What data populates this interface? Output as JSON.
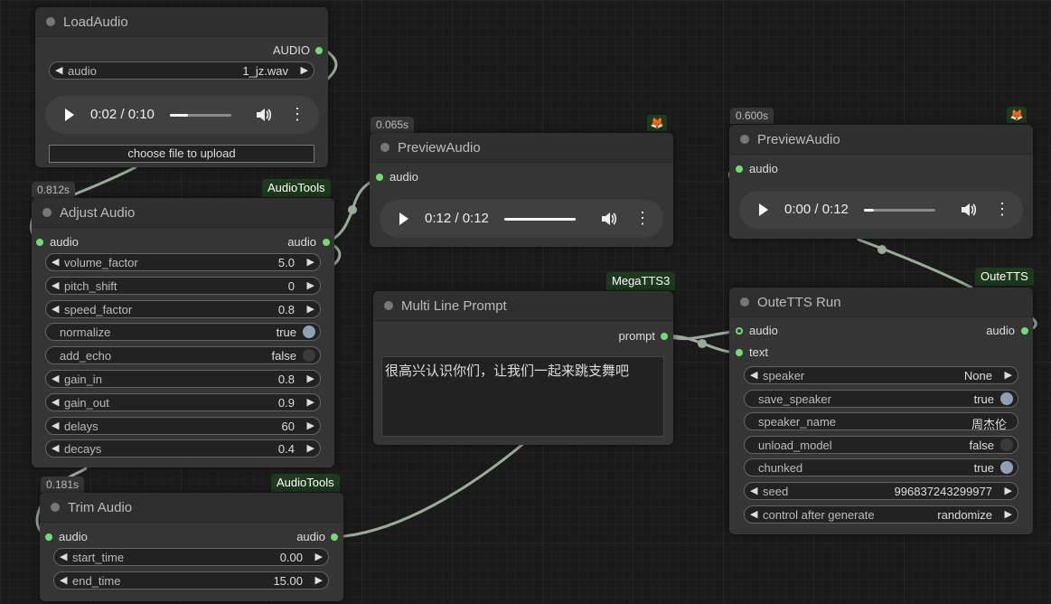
{
  "nodes": {
    "load_audio": {
      "title": "LoadAudio",
      "output_label": "AUDIO",
      "audio_label": "audio",
      "audio_value": "1_jz.wav",
      "player_time": "0:02 / 0:10",
      "player_progress": 0.3,
      "upload_label": "choose file to upload"
    },
    "adjust_audio": {
      "timing": "0.812s",
      "pack": "AudioTools",
      "title": "Adjust Audio",
      "input_label": "audio",
      "output_label": "audio",
      "widgets": [
        {
          "label": "volume_factor",
          "value": "5.0"
        },
        {
          "label": "pitch_shift",
          "value": "0"
        },
        {
          "label": "speed_factor",
          "value": "0.8"
        },
        {
          "label": "normalize",
          "value": "true",
          "toggle": true
        },
        {
          "label": "add_echo",
          "value": "false",
          "toggle": true
        },
        {
          "label": "gain_in",
          "value": "0.8"
        },
        {
          "label": "gain_out",
          "value": "0.9"
        },
        {
          "label": "delays",
          "value": "60"
        },
        {
          "label": "decays",
          "value": "0.4"
        }
      ]
    },
    "trim_audio": {
      "timing": "0.181s",
      "pack": "AudioTools",
      "title": "Trim Audio",
      "input_label": "audio",
      "output_label": "audio",
      "widgets": [
        {
          "label": "start_time",
          "value": "0.00"
        },
        {
          "label": "end_time",
          "value": "15.00"
        }
      ]
    },
    "preview_audio_1": {
      "timing": "0.065s",
      "title": "PreviewAudio",
      "input_label": "audio",
      "player_time": "0:12 / 0:12",
      "player_progress": 1.0
    },
    "preview_audio_2": {
      "timing": "0.600s",
      "title": "PreviewAudio",
      "input_label": "audio",
      "player_time": "0:00 / 0:12",
      "player_progress": 0.1
    },
    "multi_line_prompt": {
      "pack": "MegaTTS3",
      "title": "Multi Line Prompt",
      "output_label": "prompt",
      "text": "很高兴认识你们，让我们一起来跳支舞吧"
    },
    "outetts_run": {
      "pack": "OuteTTS",
      "title": "OuteTTS Run",
      "input_audio": "audio",
      "input_text": "text",
      "output_label": "audio",
      "widgets": [
        {
          "label": "speaker",
          "value": "None"
        },
        {
          "label": "save_speaker",
          "value": "true",
          "toggle": true
        },
        {
          "label": "speaker_name",
          "value": "周杰伦",
          "plain": true
        },
        {
          "label": "unload_model",
          "value": "false",
          "toggle": true
        },
        {
          "label": "chunked",
          "value": "true",
          "toggle": true
        },
        {
          "label": "seed",
          "value": "996837243299977"
        },
        {
          "label": "control after generate",
          "value": "randomize"
        }
      ]
    }
  },
  "colors": {
    "socket": "#6fe06f",
    "link": "#9bab9b",
    "pack_badge_bg": "#1d3a1d",
    "toggle_on": "#8f9fb5"
  },
  "icons": {
    "arrow_left": "◀",
    "arrow_right": "▶",
    "more": "⋮"
  }
}
